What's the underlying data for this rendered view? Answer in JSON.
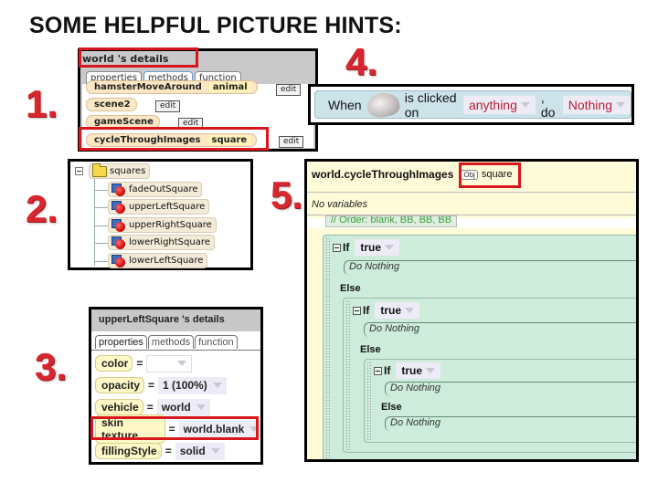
{
  "title": "SOME HELPFUL PICTURE  HINTS:",
  "hint_numbers": [
    "1.",
    "2.",
    "3.",
    "4.",
    "5."
  ],
  "colors": {
    "hint_red": "#d9262e",
    "highlight_box": "#d8161b",
    "method_tile": "#fbe7c4",
    "event_bg": "#cde3ea",
    "editor_bg": "#fefbd8",
    "if_block_bg": "#cdecdb",
    "dropdown_text": "#b51f35"
  },
  "panel1": {
    "header": "world 's details",
    "tabs": [
      "properties",
      "methods",
      "function"
    ],
    "active_tab": "methods",
    "methods": [
      {
        "name": "hamsterMoveAround",
        "param": "animal",
        "button": "edit"
      },
      {
        "name": "scene2",
        "param": "",
        "button": "edit"
      },
      {
        "name": "gameScene",
        "param": "",
        "button": "edit"
      },
      {
        "name": "cycleThroughImages",
        "param": "square",
        "button": "edit"
      }
    ]
  },
  "panel2": {
    "folder": {
      "name": "squares",
      "icon": "folder-icon"
    },
    "items": [
      {
        "name": "fadeOutSquare",
        "icon": "object-icon"
      },
      {
        "name": "upperLeftSquare",
        "icon": "object-icon"
      },
      {
        "name": "upperRightSquare",
        "icon": "object-icon"
      },
      {
        "name": "lowerRightSquare",
        "icon": "object-icon"
      },
      {
        "name": "lowerLeftSquare",
        "icon": "object-icon"
      }
    ]
  },
  "panel3": {
    "header": "upperLeftSquare 's details",
    "tabs": [
      "properties",
      "methods",
      "function"
    ],
    "active_tab": "properties",
    "properties": [
      {
        "name": "color",
        "equals": "=",
        "value": ""
      },
      {
        "name": "opacity",
        "equals": "=",
        "value": "1 (100%)"
      },
      {
        "name": "vehicle",
        "equals": "=",
        "value": "world"
      },
      {
        "name": "skin texture",
        "equals": "=",
        "value": "world.blank"
      },
      {
        "name": "fillingStyle",
        "equals": "=",
        "value": "solid"
      }
    ]
  },
  "panel4": {
    "when": "When",
    "object_icon": "mouse-icon",
    "clicked_text": "is clicked on",
    "target": "anything",
    "comma_do": ", do",
    "action": "Nothing"
  },
  "panel5": {
    "method_name": "world.cycleThroughImages",
    "param_badge": "Obj",
    "param_name": "square",
    "no_variables": "No variables",
    "comment": "// Order: blank, BB, BB, BB",
    "if_label": "If",
    "condition": "true",
    "do_nothing": "Do Nothing",
    "else_label": "Else"
  }
}
